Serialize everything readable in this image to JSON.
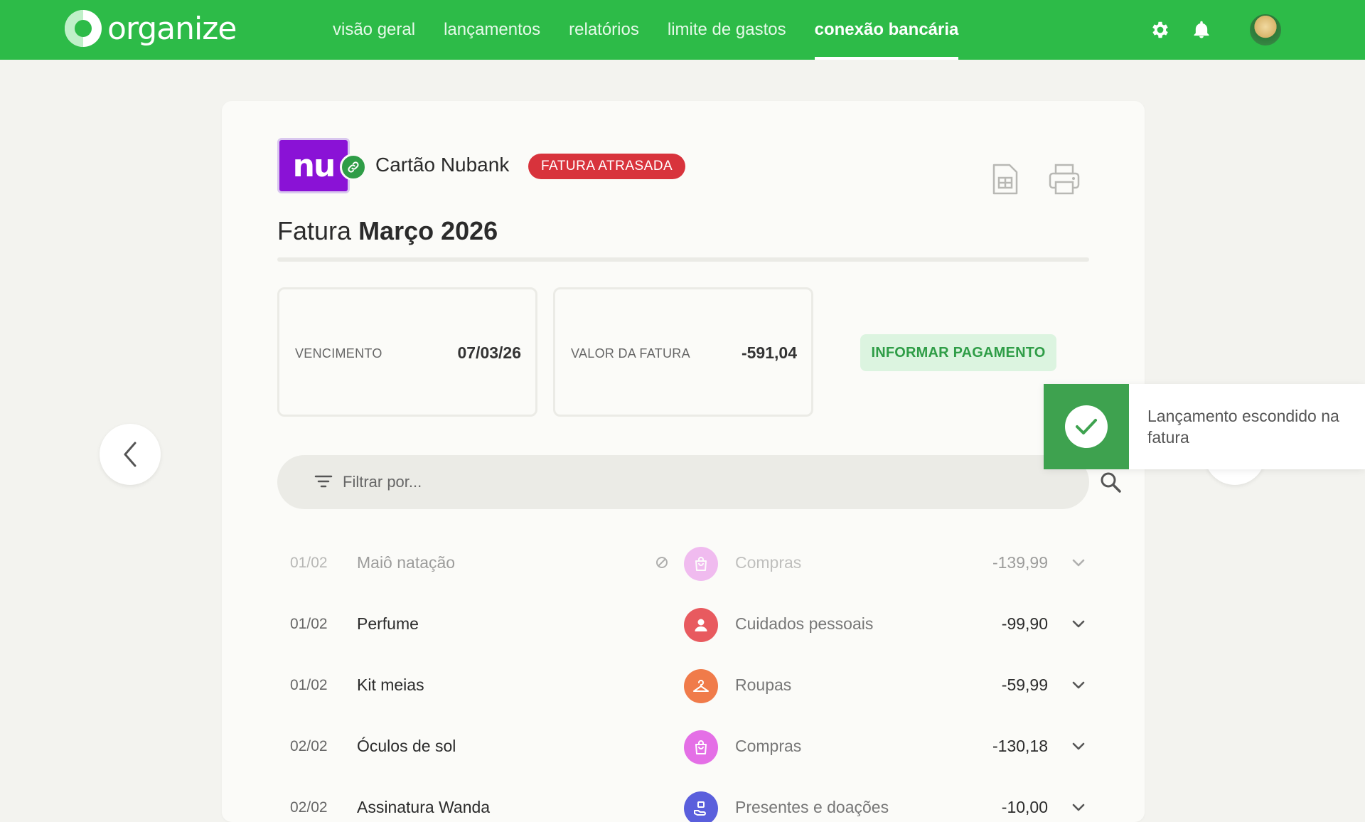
{
  "app": {
    "logo_text": "organize",
    "brand_color": "#2dbb48"
  },
  "nav": {
    "items": [
      {
        "label": "visão geral",
        "active": false
      },
      {
        "label": "lançamentos",
        "active": false
      },
      {
        "label": "relatórios",
        "active": false
      },
      {
        "label": "limite de gastos",
        "active": false
      },
      {
        "label": "conexão bancária",
        "active": true
      }
    ],
    "icons": [
      "gear-icon",
      "bell-icon",
      "avatar"
    ]
  },
  "card": {
    "bank_logo_text": "nu",
    "name": "Cartão Nubank",
    "status_badge": "FATURA ATRASADA",
    "invoice_prefix": "Fatura",
    "invoice_period": "Março 2026",
    "actions": [
      "spreadsheet-icon",
      "printer-icon"
    ]
  },
  "summary": {
    "due_label": "VENCIMENTO",
    "due_value": "07/03/26",
    "amount_label": "VALOR DA FATURA",
    "amount_value": "-591,04",
    "pay_button": "INFORMAR PAGAMENTO"
  },
  "filter": {
    "placeholder": "Filtrar por...",
    "value": ""
  },
  "transactions": [
    {
      "date": "01/02",
      "description": "Maiô natação",
      "category": "Compras",
      "category_color": "#e46fe6",
      "amount": "-139,99",
      "hidden": true,
      "icon": "shopping-bag-icon"
    },
    {
      "date": "01/02",
      "description": "Perfume",
      "category": "Cuidados pessoais",
      "category_color": "#e85a5f",
      "amount": "-99,90",
      "hidden": false,
      "icon": "person-icon"
    },
    {
      "date": "01/02",
      "description": "Kit meias",
      "category": "Roupas",
      "category_color": "#f07b4a",
      "amount": "-59,99",
      "hidden": false,
      "icon": "hanger-icon"
    },
    {
      "date": "02/02",
      "description": "Óculos de sol",
      "category": "Compras",
      "category_color": "#e46fe6",
      "amount": "-130,18",
      "hidden": false,
      "icon": "shopping-bag-icon"
    },
    {
      "date": "02/02",
      "description": "Assinatura Wanda",
      "category": "Presentes e doações",
      "category_color": "#5a5fdc",
      "amount": "-10,00",
      "hidden": false,
      "icon": "gift-hand-icon"
    }
  ],
  "toast": {
    "message": "Lançamento escondido na fatura",
    "color": "#3ea24f"
  }
}
